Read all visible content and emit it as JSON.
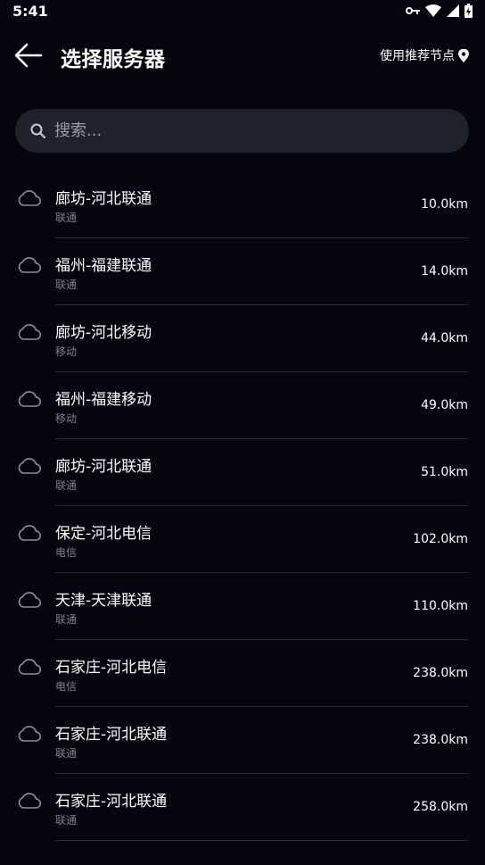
{
  "status_bar": {
    "time": "5:41"
  },
  "header": {
    "title": "选择服务器",
    "recommend_label": "使用推荐节点"
  },
  "search": {
    "placeholder": "搜索..."
  },
  "servers": [
    {
      "name": "廊坊-河北联通",
      "carrier": "联通",
      "distance": "10.0km"
    },
    {
      "name": "福州-福建联通",
      "carrier": "联通",
      "distance": "14.0km"
    },
    {
      "name": "廊坊-河北移动",
      "carrier": "移动",
      "distance": "44.0km"
    },
    {
      "name": "福州-福建移动",
      "carrier": "移动",
      "distance": "49.0km"
    },
    {
      "name": "廊坊-河北联通",
      "carrier": "联通",
      "distance": "51.0km"
    },
    {
      "name": "保定-河北电信",
      "carrier": "电信",
      "distance": "102.0km"
    },
    {
      "name": "天津-天津联通",
      "carrier": "联通",
      "distance": "110.0km"
    },
    {
      "name": "石家庄-河北电信",
      "carrier": "电信",
      "distance": "238.0km"
    },
    {
      "name": "石家庄-河北联通",
      "carrier": "联通",
      "distance": "238.0km"
    },
    {
      "name": "石家庄-河北联通",
      "carrier": "联通",
      "distance": "258.0km"
    }
  ],
  "colors": {
    "background": "#05050f",
    "search_background": "#1f212c",
    "secondary_text": "#80828c"
  },
  "icons": {
    "back": "arrow-left-icon",
    "location": "location-pin-icon",
    "search": "search-icon",
    "server": "cloud-icon"
  }
}
